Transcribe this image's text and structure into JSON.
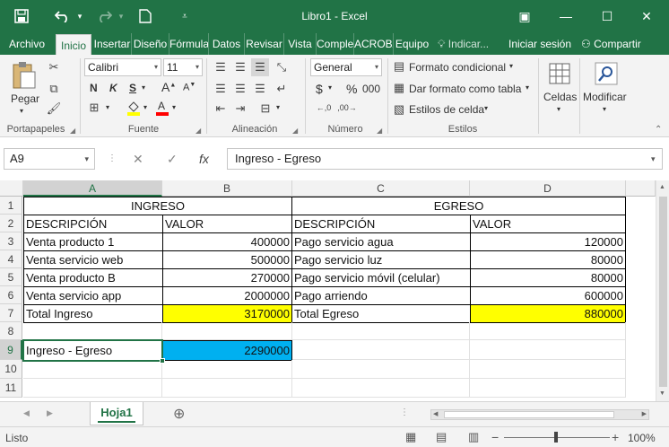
{
  "titlebar": {
    "title": "Libro1 - Excel",
    "save_icon": "save-icon",
    "undo_icon": "undo-icon",
    "redo_icon": "redo-icon",
    "new_icon": "new-document-icon",
    "qat_icon": "customize-quick-access-icon",
    "window": {
      "ribbon_opts": "▣",
      "minimize": "—",
      "maximize": "☐",
      "close": "✕"
    }
  },
  "tabs": [
    {
      "label": "Archivo",
      "active": false
    },
    {
      "label": "Inicio",
      "active": true
    },
    {
      "label": "Insertar",
      "active": false
    },
    {
      "label": "Diseño",
      "active": false
    },
    {
      "label": "Fórmulas",
      "active": false
    },
    {
      "label": "Datos",
      "active": false
    },
    {
      "label": "Revisar",
      "active": false
    },
    {
      "label": "Vista",
      "active": false
    },
    {
      "label": "Complementos",
      "active": false
    },
    {
      "label": "ACROBAT",
      "active": false
    },
    {
      "label": "Equipo",
      "active": false
    }
  ],
  "tell_me": "Indicar...",
  "signin": "Iniciar sesión",
  "share": "Compartir",
  "ribbon": {
    "clipboard": {
      "paste": "Pegar",
      "label": "Portapapeles"
    },
    "font": {
      "name": "Calibri",
      "size": "11",
      "bold": "N",
      "italic": "K",
      "underline": "S",
      "label": "Fuente",
      "fill_color": "#ffff00",
      "font_color": "#ff0000"
    },
    "alignment": {
      "label": "Alineación"
    },
    "number": {
      "format": "General",
      "currency": "$",
      "percent": "%",
      "thousands": "000",
      "label": "Número"
    },
    "styles": {
      "conditional": "Formato condicional",
      "as_table": "Dar formato como tabla",
      "cell_styles": "Estilos de celda",
      "label": "Estilos"
    },
    "cells": {
      "label": "Celdas"
    },
    "editing": {
      "label": "Modificar"
    }
  },
  "formula_bar": {
    "name_box": "A9",
    "cancel": "✕",
    "enter": "✓",
    "fx": "fx",
    "content": "Ingreso - Egreso"
  },
  "grid": {
    "columns": [
      "A",
      "B",
      "C",
      "D"
    ],
    "rows": [
      "1",
      "2",
      "3",
      "4",
      "5",
      "6",
      "7",
      "8",
      "9",
      "10",
      "11"
    ],
    "selected_col": "A",
    "selected_row": "9",
    "cells": {
      "ingreso_header": "INGRESO",
      "egreso_header": "EGRESO",
      "desc_a": "DESCRIPCIÓN",
      "valor_b": "VALOR",
      "desc_c": "DESCRIPCIÓN",
      "valor_d": "VALOR",
      "a3": "Venta producto 1",
      "b3": "400000",
      "a4": "Venta servicio web",
      "b4": "500000",
      "a5": "Venta producto B",
      "b5": "270000",
      "a6": "Venta servicio app",
      "b6": "2000000",
      "a7": "Total Ingreso",
      "b7": "3170000",
      "c3": "Pago servicio agua",
      "d3": "120000",
      "c4": "Pago servicio luz",
      "d4": "80000",
      "c5": "Pago servicio móvil (celular)",
      "d5": "80000",
      "c6": "Pago arriendo",
      "d6": "600000",
      "c7": "Total Egreso",
      "d7": "880000",
      "a9": "Ingreso - Egreso",
      "b9": "2290000"
    },
    "highlight_yellow": "#ffff00",
    "highlight_blue": "#00b0f0"
  },
  "sheets": {
    "active": "Hoja1",
    "add": "⊕"
  },
  "status": {
    "mode": "Listo",
    "zoom": "100%",
    "zoom_minus": "−",
    "zoom_plus": "+"
  },
  "accent": "#217346"
}
